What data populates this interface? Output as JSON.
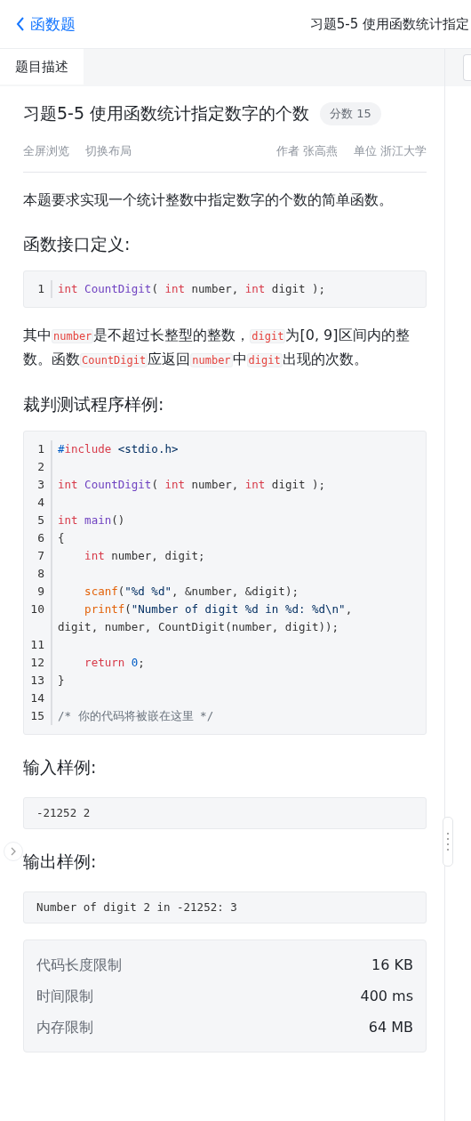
{
  "header": {
    "back_label": "函数题",
    "title": "习题5-5 使用函数统计指定"
  },
  "tabs": [
    {
      "label": "题目描述",
      "selected": true
    }
  ],
  "problem": {
    "title": "习题5-5 使用函数统计指定数字的个数",
    "score": "分数 15",
    "actions": [
      "全屏浏览",
      "切换布局"
    ],
    "meta": [
      "作者 张高燕",
      "单位 浙江大学"
    ]
  },
  "blocks": [
    {
      "kind": "paragraph",
      "segments": [
        {
          "kind": "text",
          "text": "本题要求实现一个统计整数中指定数字的个数的简单函数。"
        }
      ]
    },
    {
      "kind": "heading",
      "text": "函数接口定义:"
    },
    {
      "kind": "code",
      "lines": [
        {
          "number": "1",
          "tokens": [
            {
              "kind": "keyword",
              "text": "int"
            },
            {
              "kind": "func",
              "text": " CountDigit"
            },
            {
              "kind": "plain",
              "text": "( "
            },
            {
              "kind": "keyword",
              "text": "int"
            },
            {
              "kind": "plain",
              "text": " number, "
            },
            {
              "kind": "keyword",
              "text": "int"
            },
            {
              "kind": "plain",
              "text": " digit );"
            }
          ]
        }
      ]
    },
    {
      "kind": "paragraph",
      "segments": [
        {
          "kind": "text",
          "text": "其中"
        },
        {
          "kind": "code",
          "text": "number"
        },
        {
          "kind": "text",
          "text": "是不超过长整型的整数，"
        },
        {
          "kind": "code",
          "text": "digit"
        },
        {
          "kind": "text",
          "text": "为[0, 9]区间内的整数。函数"
        },
        {
          "kind": "code",
          "text": "CountDigit"
        },
        {
          "kind": "text",
          "text": "应返回"
        },
        {
          "kind": "code",
          "text": "number"
        },
        {
          "kind": "text",
          "text": "中"
        },
        {
          "kind": "code",
          "text": "digit"
        },
        {
          "kind": "text",
          "text": "出现的次数。"
        }
      ]
    },
    {
      "kind": "heading",
      "text": "裁判测试程序样例:"
    },
    {
      "kind": "code",
      "lines": [
        {
          "number": "1",
          "tokens": [
            {
              "kind": "preproc",
              "text": "#"
            },
            {
              "kind": "keyword",
              "text": "include"
            },
            {
              "kind": "string",
              "text": " <stdio.h>"
            }
          ]
        },
        {
          "number": "2"
        },
        {
          "number": "3",
          "tokens": [
            {
              "kind": "keyword",
              "text": "int"
            },
            {
              "kind": "func",
              "text": " CountDigit"
            },
            {
              "kind": "plain",
              "text": "( "
            },
            {
              "kind": "keyword",
              "text": "int"
            },
            {
              "kind": "plain",
              "text": " number, "
            },
            {
              "kind": "keyword",
              "text": "int"
            },
            {
              "kind": "plain",
              "text": " digit );"
            }
          ]
        },
        {
          "number": "4"
        },
        {
          "number": "5",
          "tokens": [
            {
              "kind": "keyword",
              "text": "int"
            },
            {
              "kind": "func",
              "text": " main"
            },
            {
              "kind": "plain",
              "text": "()"
            }
          ]
        },
        {
          "number": "6",
          "tokens": [
            {
              "kind": "plain",
              "text": "{"
            }
          ]
        },
        {
          "number": "7",
          "tokens": [
            {
              "kind": "keyword",
              "text": "    int"
            },
            {
              "kind": "plain",
              "text": " number, digit;"
            }
          ]
        },
        {
          "number": "8"
        },
        {
          "number": "9",
          "tokens": [
            {
              "kind": "builtin",
              "text": "    scanf"
            },
            {
              "kind": "plain",
              "text": "("
            },
            {
              "kind": "string",
              "text": "\"%d %d\""
            },
            {
              "kind": "plain",
              "text": ", &number, &digit);"
            }
          ]
        },
        {
          "number": "10",
          "tokens": [
            {
              "kind": "builtin",
              "text": "    printf"
            },
            {
              "kind": "plain",
              "text": "("
            },
            {
              "kind": "string",
              "text": "\"Number of digit %d in %d: %d\\n\""
            },
            {
              "kind": "plain",
              "text": ","
            }
          ],
          "continuation": "digit, number, CountDigit(number, digit));"
        },
        {
          "number": "11"
        },
        {
          "number": "12",
          "tokens": [
            {
              "kind": "keyword",
              "text": "    return"
            },
            {
              "kind": "number",
              "text": " 0"
            },
            {
              "kind": "plain",
              "text": ";"
            }
          ]
        },
        {
          "number": "13",
          "tokens": [
            {
              "kind": "plain",
              "text": "}"
            }
          ]
        },
        {
          "number": "14"
        },
        {
          "number": "15",
          "tokens": [
            {
              "kind": "comment",
              "text": "/* 你的代码将被嵌在这里 */"
            }
          ]
        }
      ]
    },
    {
      "kind": "heading",
      "text": "输入样例:"
    },
    {
      "kind": "sample",
      "text": "-21252 2"
    },
    {
      "kind": "heading",
      "text": "输出样例:"
    },
    {
      "kind": "sample",
      "text": "Number of digit 2 in -21252: 3"
    }
  ],
  "limits": [
    {
      "label": "代码长度限制",
      "value": "16 KB"
    },
    {
      "label": "时间限制",
      "value": "400 ms"
    },
    {
      "label": "内存限制",
      "value": "64 MB"
    }
  ]
}
